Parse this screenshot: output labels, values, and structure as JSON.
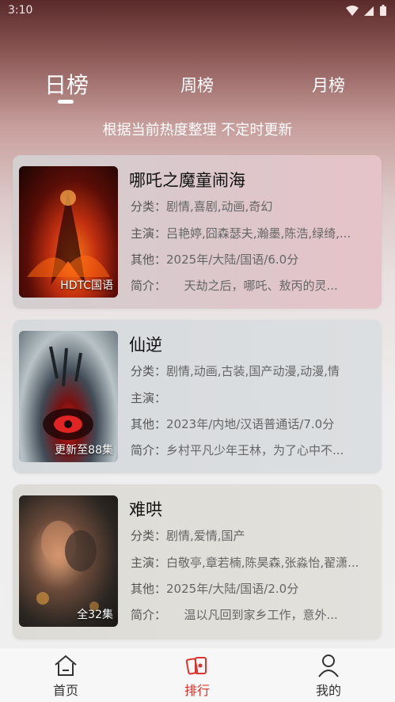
{
  "status": {
    "time": "3:10"
  },
  "tabs": {
    "daily": "日榜",
    "weekly": "周榜",
    "monthly": "月榜"
  },
  "subtitle": "根据当前热度整理 不定时更新",
  "items": [
    {
      "title": "哪吒之魔童闹海",
      "badge": "HDTC国语",
      "category_label": "分类：",
      "category": "剧情,喜剧,动画,奇幻",
      "cast_label": "主演：",
      "cast": "吕艳婷,囧森瑟夫,瀚墨,陈浩,绿绮,...",
      "other_label": "其他：",
      "other": "2025年/大陆/国语/6.0分",
      "intro_label": "简介：",
      "intro": "　　天劫之后，哪吒、敖丙的灵..."
    },
    {
      "title": "仙逆",
      "badge": "更新至88集",
      "category_label": "分类：",
      "category": "剧情,动画,古装,国产动漫,动漫,情",
      "cast_label": "主演：",
      "cast": "",
      "other_label": "其他：",
      "other": "2023年/内地/汉语普通话/7.0分",
      "intro_label": "简介：",
      "intro": "乡村平凡少年王林，为了心中不..."
    },
    {
      "title": "难哄",
      "badge": "全32集",
      "category_label": "分类：",
      "category": "剧情,爱情,国产",
      "cast_label": "主演：",
      "cast": "白敬亭,章若楠,陈昊森,张淼怡,翟潇...",
      "other_label": "其他：",
      "other": "2025年/大陆/国语/2.0分",
      "intro_label": "简介：",
      "intro": "　　温以凡回到家乡工作，意外..."
    }
  ],
  "nav": {
    "home": "首页",
    "rank": "排行",
    "me": "我的",
    "active_color": "#e0322c"
  }
}
